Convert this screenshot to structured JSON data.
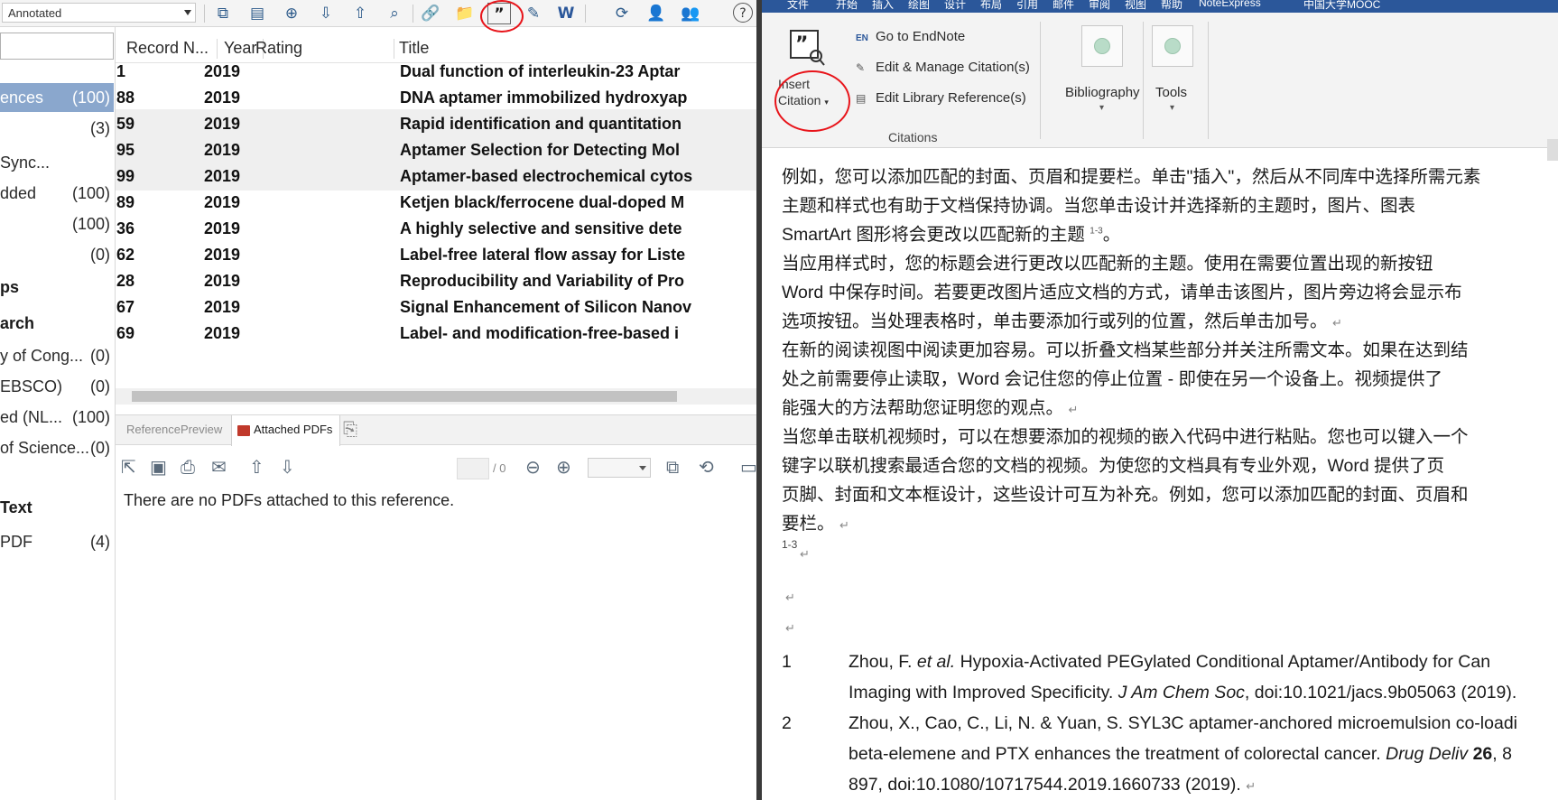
{
  "endnote": {
    "style_select": "Annotated",
    "sidebar": {
      "items": [
        {
          "label": "ences",
          "count": "(100)",
          "selected": true
        },
        {
          "label": "",
          "count": "(3)"
        },
        {
          "label": "Sync...",
          "count": ""
        },
        {
          "label": "dded",
          "count": "(100)"
        },
        {
          "label": "",
          "count": "(100)"
        },
        {
          "label": "",
          "count": "(0)"
        }
      ],
      "heading_groups": "ps",
      "heading_search": "arch",
      "search_items": [
        {
          "label": "y of Cong...",
          "count": "(0)"
        },
        {
          "label": "EBSCO)",
          "count": "(0)"
        },
        {
          "label": "ed (NL...",
          "count": "(100)"
        },
        {
          "label": "of Science...",
          "count": "(0)"
        }
      ],
      "heading_text": "Text",
      "text_items": [
        {
          "label": "PDF",
          "count": "(4)"
        }
      ]
    },
    "grid": {
      "columns": [
        "Record N...",
        "Year",
        "Rating",
        "Title"
      ],
      "rows": [
        {
          "record": "1",
          "year": "2019",
          "title": "Dual function of interleukin-23 Aptar"
        },
        {
          "record": "88",
          "year": "2019",
          "title": "DNA aptamer immobilized hydroxyap"
        },
        {
          "record": "59",
          "year": "2019",
          "title": "Rapid identification and quantitation"
        },
        {
          "record": "95",
          "year": "2019",
          "title": "Aptamer Selection for Detecting Mol"
        },
        {
          "record": "99",
          "year": "2019",
          "title": "Aptamer-based electrochemical cytos"
        },
        {
          "record": "89",
          "year": "2019",
          "title": "Ketjen black/ferrocene dual-doped M"
        },
        {
          "record": "36",
          "year": "2019",
          "title": "A highly selective and sensitive dete"
        },
        {
          "record": "62",
          "year": "2019",
          "title": "Label-free lateral flow assay for Liste"
        },
        {
          "record": "28",
          "year": "2019",
          "title": "Reproducibility and Variability of Pro"
        },
        {
          "record": "67",
          "year": "2019",
          "title": "Signal Enhancement of Silicon Nanov"
        },
        {
          "record": "69",
          "year": "2019",
          "title": "Label- and modification-free-based i"
        }
      ]
    },
    "tabs": [
      "Reference",
      "Preview",
      "Attached PDFs"
    ],
    "pdf_page_total": "/ 0",
    "no_pdf_message": "There are no PDFs attached to this reference."
  },
  "word": {
    "menu": [
      "文件",
      "开始",
      "插入",
      "绘图",
      "设计",
      "布局",
      "引用",
      "邮件",
      "审阅",
      "视图",
      "帮助",
      "NoteExpress"
    ],
    "watermark": "中国大学MOOC",
    "ribbon": {
      "insert_citation_line1": "Insert",
      "insert_citation_line2": "Citation",
      "go_to_endnote": "Go to EndNote",
      "edit_manage": "Edit & Manage Citation(s)",
      "edit_library": "Edit Library Reference(s)",
      "group_label": "Citations",
      "bibliography": "Bibliography",
      "tools": "Tools"
    },
    "doc": {
      "p1": "例如，您可以添加匹配的封面、页眉和提要栏。单击\"插入\"，然后从不同库中选择所需元素",
      "p2": "主题和样式也有助于文档保持协调。当您单击设计并选择新的主题时，图片、图表",
      "p3": "SmartArt 图形将会更改以匹配新的主题",
      "p3_cite": "1-3",
      "p4": "当应用样式时，您的标题会进行更改以匹配新的主题。使用在需要位置出现的新按钮",
      "p5": "Word 中保存时间。若要更改图片适应文档的方式，请单击该图片，图片旁边将会显示布",
      "p6": "选项按钮。当处理表格时，单击要添加行或列的位置，然后单击加号。",
      "p7": "在新的阅读视图中阅读更加容易。可以折叠文档某些部分并关注所需文本。如果在达到结",
      "p8": "处之前需要停止读取，Word 会记住您的停止位置 - 即使在另一个设备上。视频提供了",
      "p9": "能强大的方法帮助您证明您的观点。",
      "p10": "当您单击联机视频时，可以在想要添加的视频的嵌入代码中进行粘贴。您也可以键入一个",
      "p11": "键字以联机搜索最适合您的文档的视频。为使您的文档具有专业外观，Word 提供了页",
      "p12": "页脚、封面和文本框设计，这些设计可互为补充。例如，您可以添加匹配的封面、页眉和",
      "p13": "要栏。",
      "cite_marker": "1-3",
      "refs": [
        {
          "n": "1",
          "line1_a": "Zhou, F. ",
          "line1_i": "et al.",
          "line1_b": " Hypoxia-Activated PEGylated Conditional Aptamer/Antibody for Can",
          "line2_a": "Imaging with Improved Specificity. ",
          "line2_i": "J Am Chem Soc",
          "line2_b": ", doi:10.1021/jacs.9b05063 (2019)."
        },
        {
          "n": "2",
          "line1_a": "Zhou, X., Cao, C., Li, N. & Yuan, S. SYL3C aptamer-anchored microemulsion co-loadi",
          "line2_a": "beta-elemene and PTX enhances the treatment of colorectal cancer. ",
          "line2_i": "Drug Deliv",
          "line2_b": " ",
          "line2_bold": "26",
          "line2_c": ", 8",
          "line3": "897, doi:10.1080/10717544.2019.1660733 (2019)."
        }
      ]
    }
  }
}
